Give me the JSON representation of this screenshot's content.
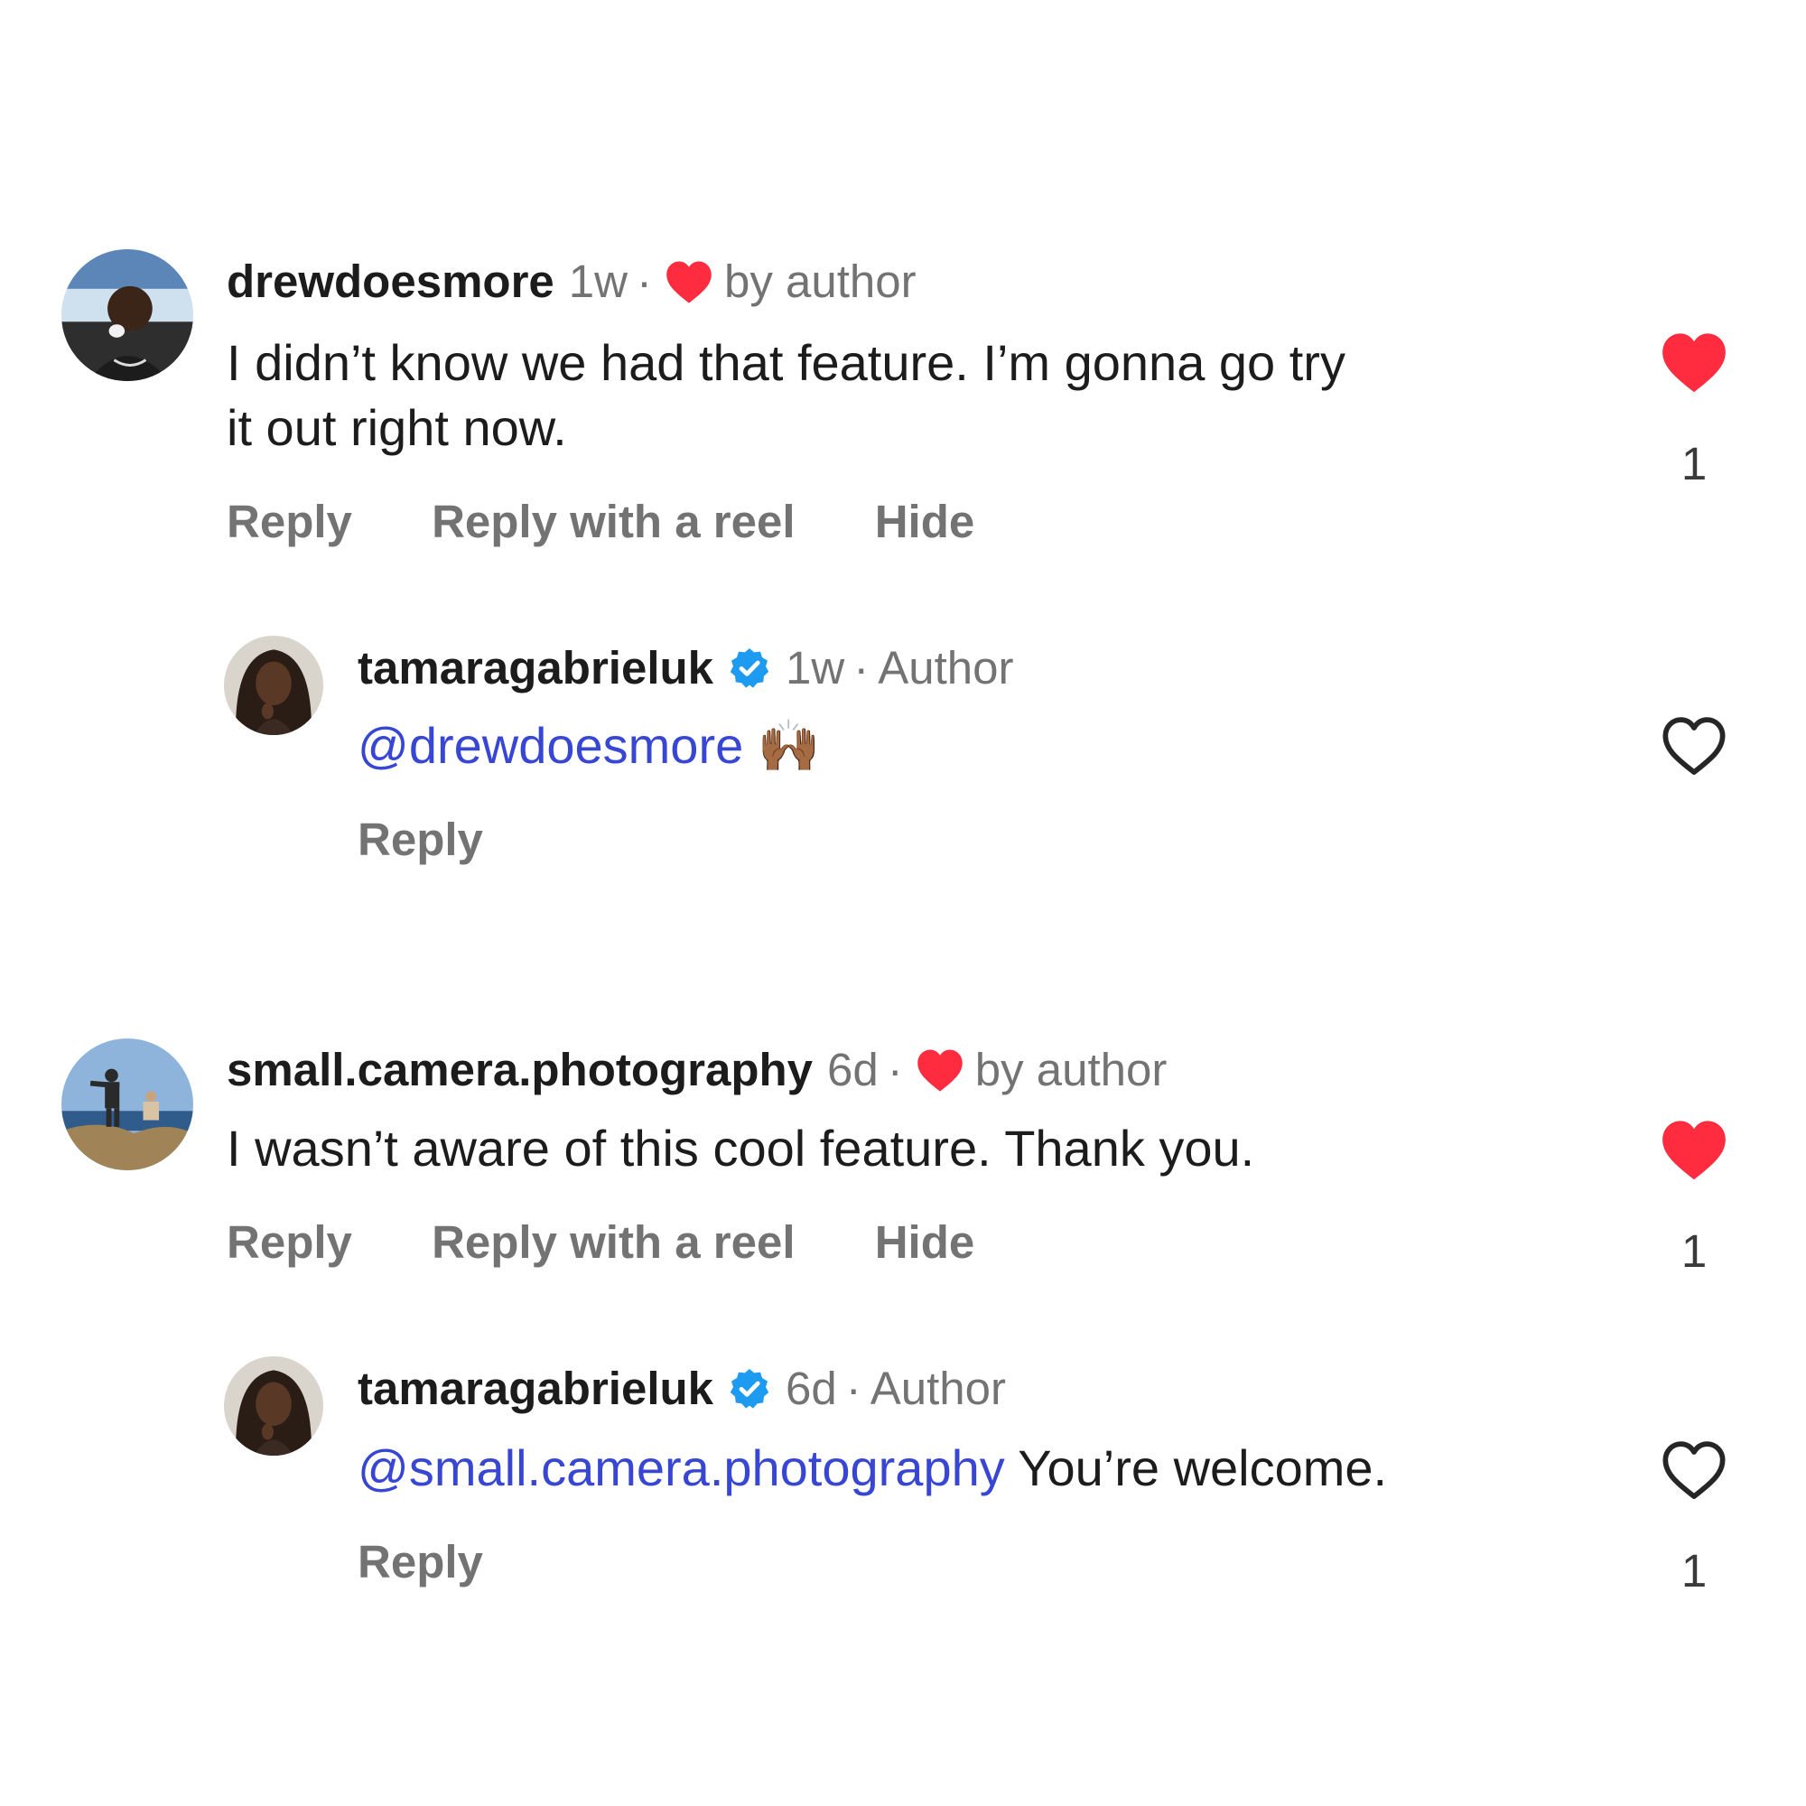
{
  "colors": {
    "like_red": "#ff2b3f",
    "mention_blue": "#3846d4",
    "verified_blue": "#1d9bf0",
    "muted_gray": "#737373"
  },
  "comments": [
    {
      "username": "drewdoesmore",
      "time": "1w",
      "separator": "·",
      "liked_by": "by author",
      "text_line1": "I didn’t know we had that feature. I’m gonna go try",
      "text_line2": "it out right now.",
      "actions": [
        "Reply",
        "Reply with a reel",
        "Hide"
      ],
      "liked": true,
      "like_count": "1",
      "reply": {
        "username": "tamaragabrieluk",
        "verified": true,
        "time": "1w",
        "separator": "·",
        "author_tag": "Author",
        "mention": "@drewdoesmore",
        "text": "",
        "emoji": "🙌🏾",
        "action": "Reply",
        "liked": false,
        "like_count": ""
      }
    },
    {
      "username": "small.camera.photography",
      "time": "6d",
      "separator": "·",
      "liked_by": "by author",
      "text_line1": "I wasn’t aware of this cool feature. Thank you.",
      "text_line2": "",
      "actions": [
        "Reply",
        "Reply with a reel",
        "Hide"
      ],
      "liked": true,
      "like_count": "1",
      "reply": {
        "username": "tamaragabrieluk",
        "verified": true,
        "time": "6d",
        "separator": "·",
        "author_tag": "Author",
        "mention": "@small.camera.photography",
        "text": " You’re welcome.",
        "emoji": "",
        "action": "Reply",
        "liked": false,
        "like_count": "1"
      }
    }
  ]
}
